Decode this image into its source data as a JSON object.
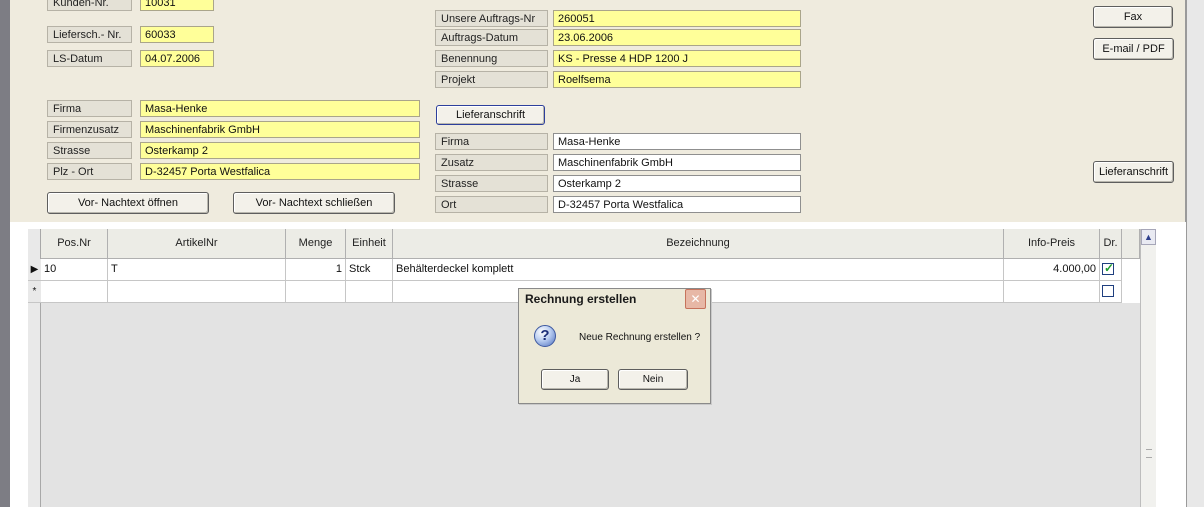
{
  "header_left": {
    "kunden_nr": {
      "label": "Kunden-Nr.",
      "value": "10031"
    },
    "liefersch_nr": {
      "label": "Liefersch.- Nr.",
      "value": "60033"
    },
    "ls_datum": {
      "label": "LS-Datum",
      "value": "04.07.2006"
    }
  },
  "address_left": {
    "firma": {
      "label": "Firma",
      "value": "Masa-Henke"
    },
    "firmenzusatz": {
      "label": "Firmenzusatz",
      "value": "Maschinenfabrik GmbH"
    },
    "strasse": {
      "label": "Strasse",
      "value": "Osterkamp 2"
    },
    "plz_ort": {
      "label": "Plz - Ort",
      "value": "D-32457 Porta Westfalica"
    }
  },
  "buttons_left": {
    "open": "Vor- Nachtext öffnen",
    "close": "Vor- Nachtext schließen"
  },
  "order": {
    "auftrags_nr": {
      "label": "Unsere Auftrags-Nr",
      "value": "260051"
    },
    "auftrags_datum": {
      "label": "Auftrags-Datum",
      "value": "23.06.2006"
    },
    "benennung": {
      "label": "Benennung",
      "value": "KS - Presse 4 HDP 1200 J"
    },
    "projekt": {
      "label": "Projekt",
      "value": "Roelfsema"
    }
  },
  "delivery": {
    "button": "Lieferanschrift",
    "firma": {
      "label": "Firma",
      "value": "Masa-Henke"
    },
    "zusatz": {
      "label": "Zusatz",
      "value": "Maschinenfabrik GmbH"
    },
    "strasse": {
      "label": "Strasse",
      "value": "Osterkamp 2"
    },
    "ort": {
      "label": "Ort",
      "value": "D-32457 Porta Westfalica"
    }
  },
  "right_buttons": {
    "fax": "Fax",
    "email": "E-mail / PDF",
    "lieferanschrift": "Lieferanschrift"
  },
  "grid": {
    "columns": {
      "pos": "Pos.Nr",
      "artikel": "ArtikelNr",
      "menge": "Menge",
      "einheit": "Einheit",
      "bez": "Bezeichnung",
      "preis": "Info-Preis",
      "dr": "Dr."
    },
    "rows": [
      {
        "pos": "10",
        "artikel": "T",
        "menge": "1",
        "einheit": "Stck",
        "bez": "Behälterdeckel komplett",
        "preis": "4.000,00",
        "dr": true,
        "marker": "▶"
      },
      {
        "pos": "",
        "artikel": "",
        "menge": "",
        "einheit": "",
        "bez": "",
        "preis": "",
        "dr": false,
        "marker": "*"
      }
    ]
  },
  "dialog": {
    "title": "Rechnung erstellen",
    "message": "Neue Rechnung erstellen ?",
    "yes": "Ja",
    "no": "Nein",
    "icon": "question-icon"
  },
  "colors": {
    "form_bg": "#efebde",
    "field_yellow": "#ffff99",
    "check_green": "#1e9e2e"
  }
}
